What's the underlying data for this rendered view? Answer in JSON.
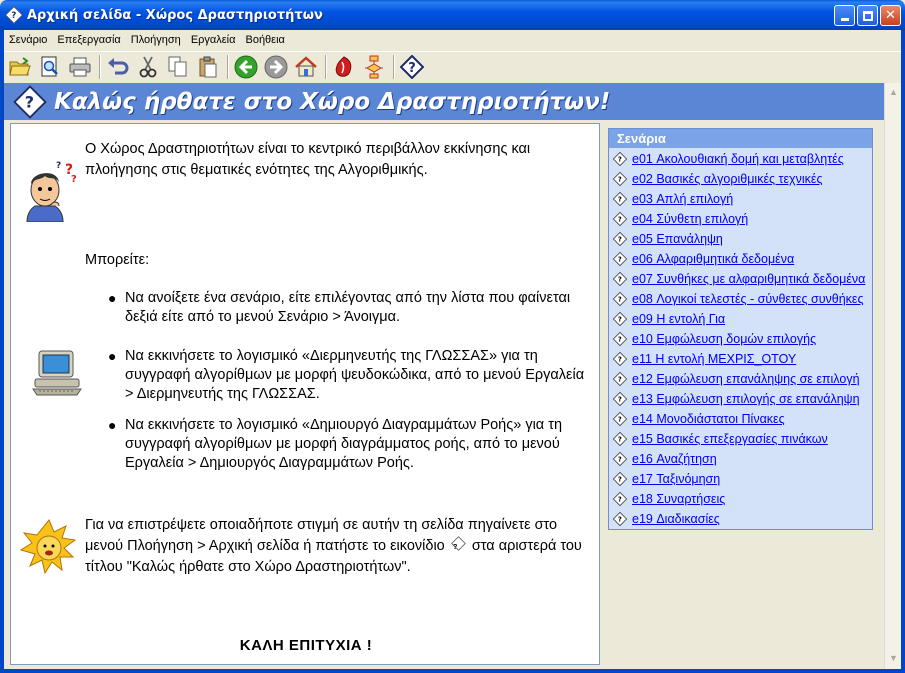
{
  "window": {
    "title": "Αρχική σελίδα - Χώρος Δραστηριοτήτων",
    "app_icon_glyph": "?",
    "close_glyph": "✕"
  },
  "menu": [
    "Σενάριο",
    "Επεξεργασία",
    "Πλοήγηση",
    "Εργαλεία",
    "Βοήθεια"
  ],
  "toolbar": {
    "buttons": [
      "open-folder-icon",
      "preview-icon",
      "print-icon",
      "undo-icon",
      "cut-icon",
      "copy-icon",
      "paste-icon",
      "back-arrow-icon",
      "forward-arrow-icon",
      "home-icon",
      "glossa-interpreter-icon",
      "flowchart-icon",
      "help-icon"
    ]
  },
  "banner": {
    "icon_glyph": "?",
    "title": "Καλώς ήρθατε στο Χώρο Δραστηριοτήτων!"
  },
  "main": {
    "intro": "Ο Χώρος Δραστηριοτήτων είναι το κεντρικό περιβάλλον εκκίνησης και πλοήγησης στις θεματικές ενότητες της Αλγοριθμικής.",
    "maybe": "Μπορείτε:",
    "bullet_glyph": "●",
    "bullets": [
      "Να ανοίξετε ένα σενάριο, είτε επιλέγοντας από την λίστα που φαίνεται δεξιά είτε από το μενού Σενάριο > Άνοιγμα.",
      "Να εκκινήσετε το λογισμικό «Διερμηνευτής της ΓΛΩΣΣΑΣ» για τη συγγραφή αλγορίθμων με μορφή ψευδοκώδικα, από το μενού Εργαλεία > Διερμηνευτής της ΓΛΩΣΣΑΣ.",
      "Να εκκινήσετε το λογισμικό «Δημιουργό Διαγραμμάτων Ροής» για τη συγγραφή αλγορίθμων με μορφή διαγράμματος ροής, από το μενού Εργαλεία > Δημιουργός Διαγραμμάτων Ροής."
    ],
    "back_text_1": "Για να επιστρέψετε οποιαδήποτε στιγμή σε αυτήν τη σελίδα πηγαίνετε στο μενού Πλοήγηση > Αρχική σελίδα ή πατήστε το εικονίδιο",
    "back_icon_glyph": "?",
    "back_text_2": "στα αριστερά του τίτλου \"Καλώς ήρθατε στο Χώρο Δραστηριοτήτων\".",
    "good_luck": "ΚΑΛΗ ΕΠΙΤΥΧΙΑ !"
  },
  "scenarios": {
    "header": "Σενάρια",
    "icon_glyph": "?",
    "items": [
      "e01 Ακολουθιακή δομή και μεταβλητές",
      "e02 Βασικές αλγοριθμικές τεχνικές",
      "e03 Απλή επιλογή",
      "e04 Σύνθετη επιλογή",
      "e05 Επανάληψη",
      "e06 Αλφαριθμητικά δεδομένα",
      "e07 Συνθήκες με αλφαριθμητικά δεδομένα",
      "e08 Λογικοί τελεστές - σύνθετες συνθήκες",
      "e09 Η εντολή Για",
      "e10 Εμφώλευση δομών επιλογής",
      "e11 Η εντολή ΜΕΧΡΙΣ_ΟΤΟΥ",
      "e12 Εμφώλευση επανάληψης σε επιλογή",
      "e13 Εμφώλευση επιλογής σε επανάληψη",
      "e14 Μονοδιάστατοι Πίνακες",
      "e15 Βασικές επεξεργασίες πινάκων",
      "e16 Αναζήτηση",
      "e17 Ταξινόμηση",
      "e18 Συναρτήσεις",
      "e19 Διαδικασίες"
    ]
  },
  "colors": {
    "titlebar": "#0054e3",
    "banner": "#5b86d6",
    "scenario_panel": "#d4e2f9",
    "scenario_header": "#7ba3e8",
    "link": "#0000ee"
  }
}
